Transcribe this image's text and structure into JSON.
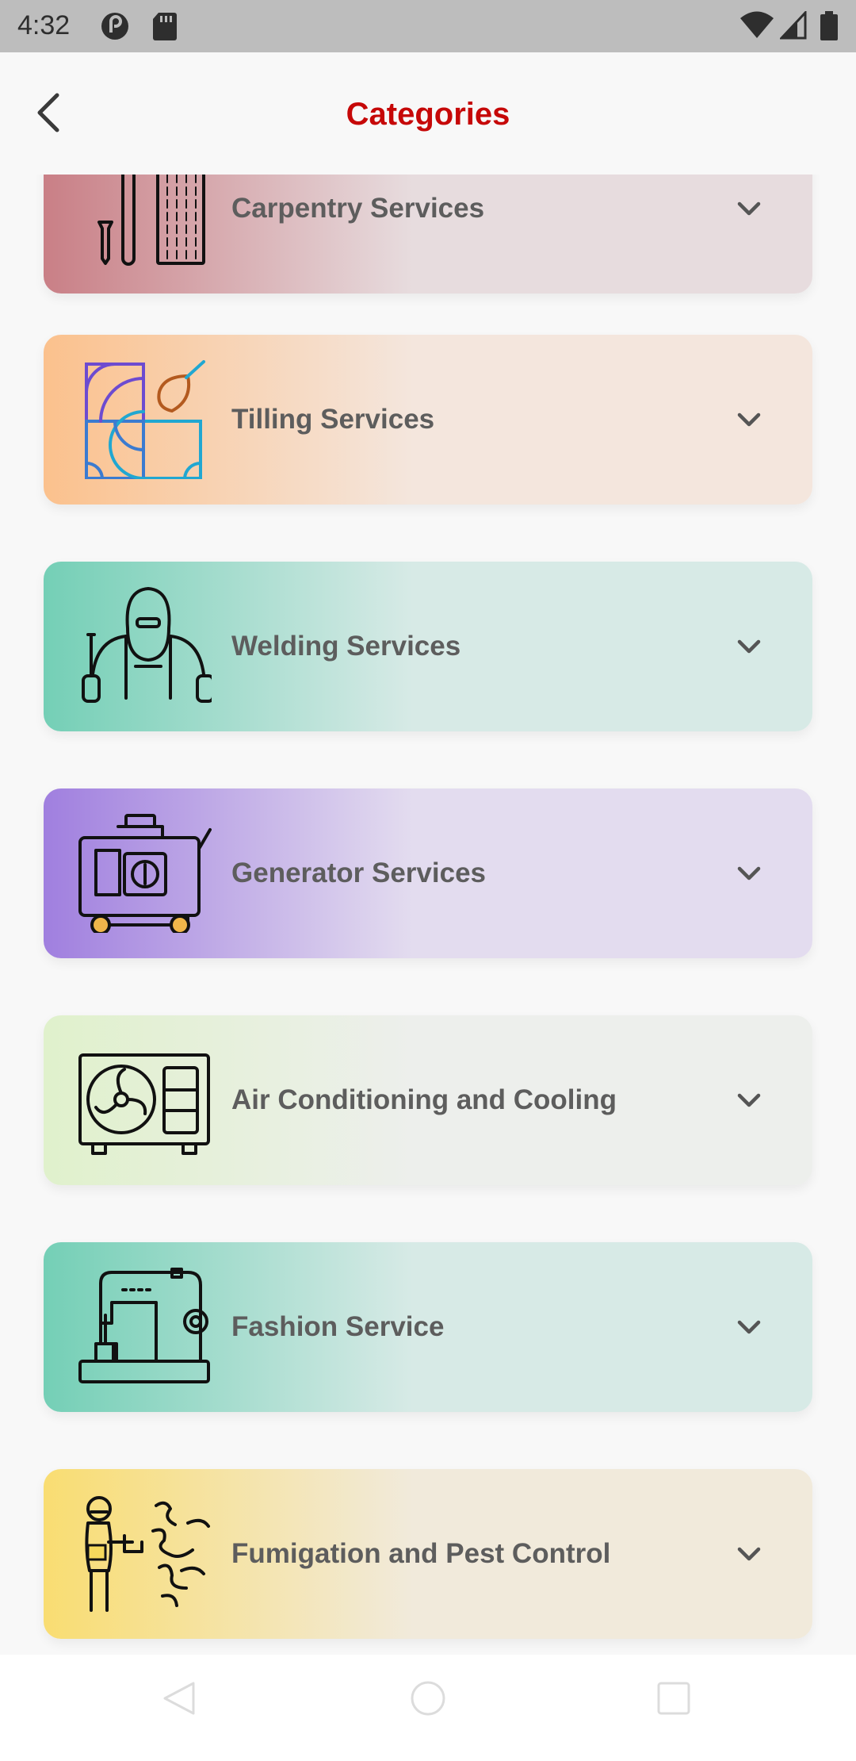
{
  "status_bar": {
    "time": "4:32",
    "icons": [
      "pocket-casts-icon",
      "sd-card-icon",
      "wifi-icon",
      "cellular-signal-icon",
      "battery-icon"
    ]
  },
  "header": {
    "title": "Categories",
    "title_color": "#c60808",
    "back_icon": "back-arrow-icon"
  },
  "categories": [
    {
      "label": "Carpentry Services",
      "icon": "carpentry-tools-icon",
      "gradient_from": "#c97f86",
      "gradient_to": "#e7dcde"
    },
    {
      "label": "Tilling Services",
      "icon": "tile-trowel-icon",
      "gradient_from": "#fbc18d",
      "gradient_to": "#f4e6dd"
    },
    {
      "label": "Welding Services",
      "icon": "welder-mask-icon",
      "gradient_from": "#74cfb6",
      "gradient_to": "#d7eae6"
    },
    {
      "label": "Generator Services",
      "icon": "generator-icon",
      "gradient_from": "#a07fdf",
      "gradient_to": "#e3dcef"
    },
    {
      "label": "Air Conditioning and Cooling",
      "icon": "ac-outdoor-unit-icon",
      "gradient_from": "#e0f1cc",
      "gradient_to": "#edefec"
    },
    {
      "label": "Fashion Service",
      "icon": "sewing-machine-icon",
      "gradient_from": "#74cfb6",
      "gradient_to": "#d7eae6"
    },
    {
      "label": "Fumigation and Pest Control",
      "icon": "fumigation-worker-icon",
      "gradient_from": "#f9dd72",
      "gradient_to": "#f1eadb"
    }
  ],
  "chevron_icon": "chevron-down-icon",
  "nav_bar": {
    "icons": [
      "nav-back-icon",
      "nav-home-icon",
      "nav-recents-icon"
    ]
  }
}
